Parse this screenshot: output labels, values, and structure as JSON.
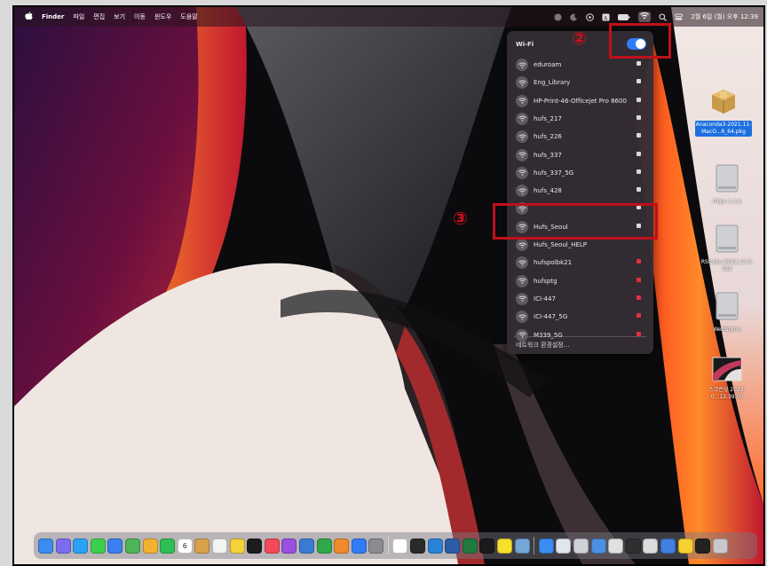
{
  "menubar": {
    "apple_icon": "apple-logo-icon",
    "app_name": "Finder",
    "menus": [
      "파일",
      "편집",
      "보기",
      "이동",
      "윈도우",
      "도움말"
    ],
    "clock": "2월 6일 (월) 오후 12:39",
    "status_icons": [
      "record-icon",
      "moon-icon",
      "play-circle-icon",
      "keyboard-icon",
      "battery-icon",
      "wifi-icon",
      "search-icon",
      "control-center-icon"
    ]
  },
  "wifi": {
    "title": "Wi-Fi",
    "toggle_on": true,
    "accent": "#2f7cf6",
    "networks": [
      {
        "name": "eduroam",
        "lock": "white"
      },
      {
        "name": "Eng_Library",
        "lock": "white"
      },
      {
        "name": "HP-Print-46-Officejet Pro 8600",
        "lock": "white"
      },
      {
        "name": "hufs_217",
        "lock": "white"
      },
      {
        "name": "hufs_226",
        "lock": "white"
      },
      {
        "name": "hufs_337",
        "lock": "white"
      },
      {
        "name": "hufs_337_5G",
        "lock": "white"
      },
      {
        "name": "hufs_428",
        "lock": "white"
      },
      {
        "name": "",
        "lock": "white"
      },
      {
        "name": "Hufs_Seoul",
        "lock": "white"
      },
      {
        "name": "Hufs_Seoul_HELP",
        "lock": "none"
      },
      {
        "name": "hufspolbk21",
        "lock": "red"
      },
      {
        "name": "hufsptg",
        "lock": "red"
      },
      {
        "name": "ICI-447",
        "lock": "red"
      },
      {
        "name": "ICI-447_5G",
        "lock": "red"
      },
      {
        "name": "M339_5G",
        "lock": "red"
      }
    ],
    "settings_label": "네트워크 환경설정..."
  },
  "annotations": {
    "step2": "②",
    "step3": "③",
    "color": "#c0101a"
  },
  "desktop_icons": [
    {
      "label": "Anaconda3-2021.11-MacO...6_64.pkg",
      "selected": true,
      "icon": "package-icon"
    },
    {
      "label": "Filips-1.0.4",
      "selected": false,
      "icon": "disk-icon"
    },
    {
      "label": "RStudio-2022.12.0-353",
      "selected": false,
      "icon": "disk-icon"
    },
    {
      "label": "WebStorm",
      "selected": false,
      "icon": "disk-icon"
    },
    {
      "label": "스크린샷 2023-0...12.39.00",
      "selected": false,
      "icon": "screenshot-thumbnail-icon"
    }
  ],
  "dock": {
    "badge": "6",
    "apps": [
      "finder",
      "launchpad",
      "safari",
      "messages",
      "mail",
      "maps",
      "photos",
      "facetime",
      "calendar",
      "contacts",
      "reminders",
      "notes",
      "appletv",
      "music",
      "podcasts",
      "keynote",
      "numbers",
      "pages",
      "appstore",
      "system-preferences",
      "chrome",
      "terminal",
      "vscode",
      "word",
      "excel",
      "webstorm",
      "kakaotalk",
      "rstudio",
      "finder2",
      "preview",
      "file1",
      "file2",
      "file3",
      "file4",
      "file5",
      "file6",
      "file7",
      "file8",
      "trash"
    ]
  }
}
